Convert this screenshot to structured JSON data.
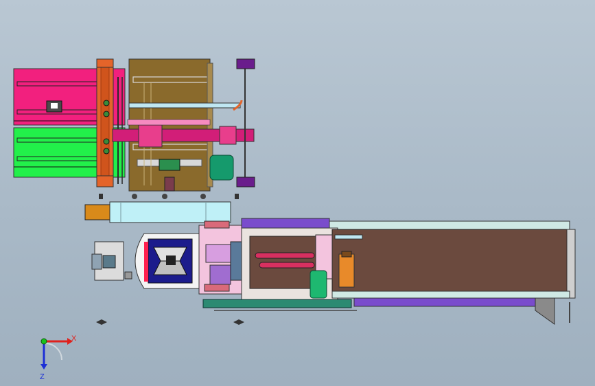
{
  "view": {
    "background_top": "#b9c7d3",
    "background_bottom": "#9fb0bf"
  },
  "triad": {
    "x_label": "X",
    "z_label": "Z",
    "x_color": "#e0201c",
    "y_color": "#19c21c",
    "z_color": "#1c2fd6"
  },
  "colors": {
    "pink_module": "#f2207e",
    "green_module": "#22f04a",
    "orange_frame": "#e4642a",
    "olive_plate": "#8a6a2c",
    "magenta_arm": "#d21e78",
    "purple_part": "#6a1d8c",
    "cyan_cylinder": "#bff0f7",
    "conveyor_belt": "#6b4a3e",
    "conveyor_frame": "#cfe9e4",
    "lavender_rail": "#7a4ccc",
    "navy_block": "#1c1c8c",
    "dark_green_tank": "#159a6c",
    "light_pink_plate": "#f3c4de"
  },
  "icons": [
    "axis-triad-icon"
  ]
}
